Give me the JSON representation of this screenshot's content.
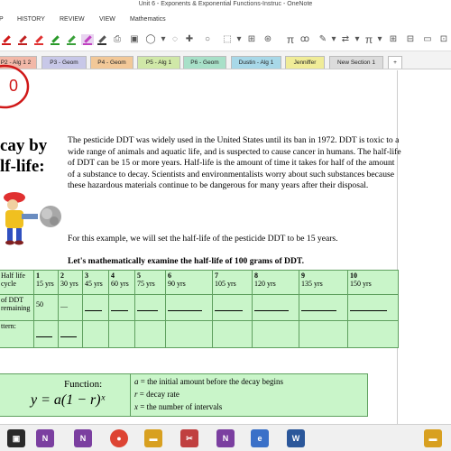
{
  "window": {
    "title": "Unit 6 - Exponents & Exponential Functions-Instruc - OneNote"
  },
  "menu": [
    "HISTORY",
    "REVIEW",
    "VIEW",
    "Mathematics"
  ],
  "section_tabs": [
    "P2 - Alg 1 2",
    "P3 - Geom",
    "P4 - Geom",
    "P5 - Alg 1",
    "P6 - Geom",
    "Dustin - Alg 1",
    "Jenniffer",
    "New Section 1",
    "+"
  ],
  "colors": {
    "accent_purple": "#7b3fa0",
    "annotation_red": "#d01818",
    "table_green": "#c9f5c9",
    "table_border": "#5fa05f"
  },
  "note": {
    "heading_line1": "cay by",
    "heading_line2": "lf-life:",
    "paragraph1": "The pesticide DDT was widely used in the United States until its ban in 1972.  DDT is toxic to a wide range of animals and aquatic life, and is suspected to cause cancer in humans.  The half-life of DDT can be 15 or more years.  Half-life is the amount of time it takes for half of the amount of a substance to decay.  Scientists and environmentalists worry about such substances because these hazardous materials  continue to be dangerous for many years after their disposal.",
    "paragraph2": "For this example, we will set the half-life of the pesticide DDT to be 15 years.",
    "subheading": "Let's mathematically examine the half-life of 100 grams of DDT."
  },
  "table": {
    "row1_label": "Half life cycle",
    "row2_label": "of DDT remaining",
    "row3_label": "ttern:",
    "cycles": [
      {
        "n": "1",
        "years": "15 yrs"
      },
      {
        "n": "2",
        "years": "30 yrs"
      },
      {
        "n": "3",
        "years": "45 yrs"
      },
      {
        "n": "4",
        "years": "60 yrs"
      },
      {
        "n": "5",
        "years": "75 yrs"
      },
      {
        "n": "6",
        "years": "90 yrs"
      },
      {
        "n": "7",
        "years": "105 yrs"
      },
      {
        "n": "8",
        "years": "120 yrs"
      },
      {
        "n": "9",
        "years": "135 yrs"
      },
      {
        "n": "10",
        "years": "150 yrs"
      }
    ],
    "first_amount": "50",
    "blank_mark": "__"
  },
  "formula_box": {
    "label": "Function:",
    "formula": "y = a(1 − r)ˣ",
    "def_a_var": "a",
    "def_a": " = the initial amount before the decay begins",
    "def_r_var": "r",
    "def_r": " = decay rate",
    "def_x_var": "x",
    "def_x": " = the number of intervals"
  },
  "annotation": {
    "circled_digit": "0"
  },
  "toolbar_icons": [
    "pen-red",
    "pen-red",
    "pen-red",
    "pen-green",
    "pen-green",
    "pen-purple",
    "highlighter-pink",
    "pen-gray",
    "printer-icon",
    "image-icon",
    "lasso-icon",
    "shapes-icon",
    "plus-icon",
    "circle-icon",
    "crop-icon",
    "graph-icon",
    "pi-icon",
    "pen-dropdown-icon",
    "arrows-icon",
    "pi-icon-2",
    "grid-icon",
    "text-icon",
    "more-icon"
  ],
  "taskbar_icons": [
    "onenote-icon",
    "onenote-n-icon",
    "chrome-icon",
    "folder-icon",
    "snip-icon",
    "onenote-active-icon",
    "ie-icon",
    "word-icon",
    "app-icon",
    "app-icon-2"
  ]
}
